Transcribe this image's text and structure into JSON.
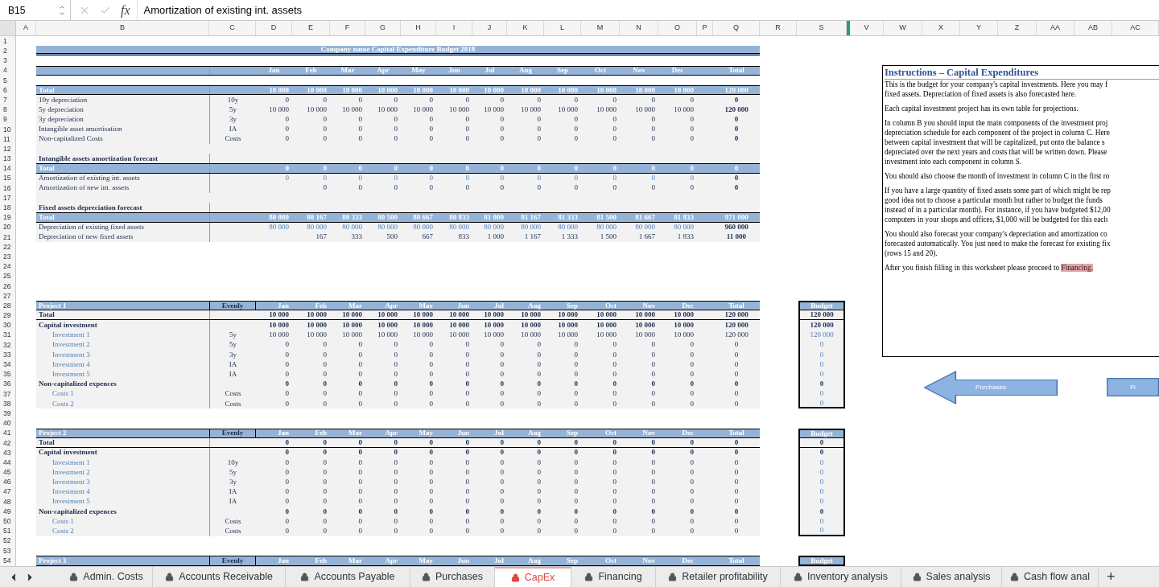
{
  "formula_bar": {
    "cell_ref": "B15",
    "fx": "fx",
    "formula": "Amortization of existing int. assets"
  },
  "columns": [
    "A",
    "B",
    "C",
    "D",
    "E",
    "F",
    "G",
    "H",
    "I",
    "J",
    "K",
    "L",
    "M",
    "N",
    "O",
    "P",
    "Q",
    "R",
    "S",
    "V",
    "W",
    "X",
    "Y",
    "Z",
    "AA",
    "AB",
    "AC"
  ],
  "rows": [
    {
      "number": "1",
      "kind": "blank"
    },
    {
      "number": "2",
      "kind": "title",
      "title": "Company name Capital Expenditure Budget 2018"
    },
    {
      "number": "3",
      "kind": "blank"
    },
    {
      "number": "4",
      "kind": "header",
      "values": [
        "Jan",
        "Feb",
        "Mar",
        "Apr",
        "May",
        "Jun",
        "Jul",
        "Aug",
        "Sep",
        "Oct",
        "Nov",
        "Dec"
      ],
      "total": "Total"
    },
    {
      "number": "5",
      "kind": "blank"
    },
    {
      "number": "6",
      "kind": "band",
      "label": "Total",
      "values": [
        "10 000",
        "10 000",
        "10 000",
        "10 000",
        "10 000",
        "10 000",
        "10 000",
        "10 000",
        "10 000",
        "10 000",
        "10 000",
        "10 000"
      ],
      "total": "120 000"
    },
    {
      "number": "7",
      "kind": "line",
      "label": "10y depreciation",
      "code": "10y",
      "values": [
        "0",
        "0",
        "0",
        "0",
        "0",
        "0",
        "0",
        "0",
        "0",
        "0",
        "0",
        "0"
      ],
      "total": "0"
    },
    {
      "number": "8",
      "kind": "line",
      "label": "5y depreciation",
      "code": "5y",
      "values": [
        "10 000",
        "10 000",
        "10 000",
        "10 000",
        "10 000",
        "10 000",
        "10 000",
        "10 000",
        "10 000",
        "10 000",
        "10 000",
        "10 000"
      ],
      "total": "120 000"
    },
    {
      "number": "9",
      "kind": "line",
      "label": "3y depreciation",
      "code": "3y",
      "values": [
        "0",
        "0",
        "0",
        "0",
        "0",
        "0",
        "0",
        "0",
        "0",
        "0",
        "0",
        "0"
      ],
      "total": "0"
    },
    {
      "number": "10",
      "kind": "line",
      "label": "Intangible asset amortisation",
      "code": "IA",
      "values": [
        "0",
        "0",
        "0",
        "0",
        "0",
        "0",
        "0",
        "0",
        "0",
        "0",
        "0",
        "0"
      ],
      "total": "0"
    },
    {
      "number": "11",
      "kind": "line",
      "label": "Non-capitalized Costs",
      "code": "Costs",
      "values": [
        "0",
        "0",
        "0",
        "0",
        "0",
        "0",
        "0",
        "0",
        "0",
        "0",
        "0",
        "0"
      ],
      "total": "0"
    },
    {
      "number": "12",
      "kind": "gap"
    },
    {
      "number": "13",
      "kind": "subheading",
      "label": "Intangible assets amortization forecast"
    },
    {
      "number": "14",
      "kind": "band",
      "label": "Total",
      "values": [
        "0",
        "0",
        "0",
        "0",
        "0",
        "0",
        "0",
        "0",
        "0",
        "0",
        "0",
        "0"
      ],
      "total": "0"
    },
    {
      "number": "15",
      "kind": "input",
      "label": "Amortization of existing int. assets",
      "values": [
        "0",
        "0",
        "0",
        "0",
        "0",
        "0",
        "0",
        "0",
        "0",
        "0",
        "0",
        "0"
      ],
      "total": "0"
    },
    {
      "number": "16",
      "kind": "line",
      "label": "Amortization of new int. assets",
      "leading_blank": true,
      "values": [
        "0",
        "0",
        "0",
        "0",
        "0",
        "0",
        "0",
        "0",
        "0",
        "0",
        "0"
      ],
      "total": "0"
    },
    {
      "number": "17",
      "kind": "gap"
    },
    {
      "number": "18",
      "kind": "subheading",
      "label": "Fixed assets depreciation forecast"
    },
    {
      "number": "19",
      "kind": "band",
      "label": "Total",
      "values": [
        "80 000",
        "80 167",
        "80 333",
        "80 500",
        "80 667",
        "80 833",
        "81 000",
        "81 167",
        "81 333",
        "81 500",
        "81 667",
        "81 833"
      ],
      "total": "971 000"
    },
    {
      "number": "20",
      "kind": "input",
      "label": "Depreciation of existing fixed assets",
      "values": [
        "80 000",
        "80 000",
        "80 000",
        "80 000",
        "80 000",
        "80 000",
        "80 000",
        "80 000",
        "80 000",
        "80 000",
        "80 000",
        "80 000"
      ],
      "total": "960 000"
    },
    {
      "number": "21",
      "kind": "line",
      "label": "Depreciation of new fixed assets",
      "leading_blank": true,
      "values": [
        "167",
        "333",
        "500",
        "667",
        "833",
        "1 000",
        "1 167",
        "1 333",
        "1 500",
        "1 667",
        "1 833"
      ],
      "total": "11 000"
    },
    {
      "number": "22",
      "kind": "blank"
    },
    {
      "number": "23",
      "kind": "blank"
    },
    {
      "number": "24",
      "kind": "blank"
    },
    {
      "number": "25",
      "kind": "blank"
    },
    {
      "number": "26",
      "kind": "blank"
    },
    {
      "number": "27",
      "kind": "blank"
    },
    {
      "number": "28",
      "kind": "project_header",
      "label": "Project 1",
      "code": "Evenly",
      "values": [
        "Jan",
        "Feb",
        "Mar",
        "Apr",
        "May",
        "Jun",
        "Jul",
        "Aug",
        "Sep",
        "Oct",
        "Nov",
        "Dec"
      ],
      "total": "Total",
      "budget": "Budget"
    },
    {
      "number": "29",
      "kind": "project_total",
      "label": "Total",
      "values": [
        "10 000",
        "10 000",
        "10 000",
        "10 000",
        "10 000",
        "10 000",
        "10 000",
        "10 000",
        "10 000",
        "10 000",
        "10 000",
        "10 000"
      ],
      "total": "120 000",
      "budget": "120 000"
    },
    {
      "number": "30",
      "kind": "group",
      "label": "Capital investment",
      "values": [
        "10 000",
        "10 000",
        "10 000",
        "10 000",
        "10 000",
        "10 000",
        "10 000",
        "10 000",
        "10 000",
        "10 000",
        "10 000",
        "10 000"
      ],
      "total": "120 000",
      "budget": "120 000"
    },
    {
      "number": "31",
      "kind": "component",
      "label": "Investment 1",
      "code": "5y",
      "values": [
        "10 000",
        "10 000",
        "10 000",
        "10 000",
        "10 000",
        "10 000",
        "10 000",
        "10 000",
        "10 000",
        "10 000",
        "10 000",
        "10 000"
      ],
      "total": "120 000",
      "budget": "120 000"
    },
    {
      "number": "32",
      "kind": "component",
      "label": "Investment 2",
      "code": "5y",
      "values": [
        "0",
        "0",
        "0",
        "0",
        "0",
        "0",
        "0",
        "0",
        "0",
        "0",
        "0",
        "0"
      ],
      "total": "0",
      "budget": "0"
    },
    {
      "number": "33",
      "kind": "component",
      "label": "Investment 3",
      "code": "3y",
      "values": [
        "0",
        "0",
        "0",
        "0",
        "0",
        "0",
        "0",
        "0",
        "0",
        "0",
        "0",
        "0"
      ],
      "total": "0",
      "budget": "0"
    },
    {
      "number": "34",
      "kind": "component",
      "label": "Investment 4",
      "code": "IA",
      "values": [
        "0",
        "0",
        "0",
        "0",
        "0",
        "0",
        "0",
        "0",
        "0",
        "0",
        "0",
        "0"
      ],
      "total": "0",
      "budget": "0"
    },
    {
      "number": "35",
      "kind": "component",
      "label": "Investment 5",
      "code": "IA",
      "values": [
        "0",
        "0",
        "0",
        "0",
        "0",
        "0",
        "0",
        "0",
        "0",
        "0",
        "0",
        "0"
      ],
      "total": "0",
      "budget": "0"
    },
    {
      "number": "36",
      "kind": "group",
      "label": "Non-capitalized expences",
      "values": [
        "0",
        "0",
        "0",
        "0",
        "0",
        "0",
        "0",
        "0",
        "0",
        "0",
        "0",
        "0"
      ],
      "total": "0",
      "budget": "0"
    },
    {
      "number": "37",
      "kind": "component",
      "label": "Costs 1",
      "code": "Costs",
      "values": [
        "0",
        "0",
        "0",
        "0",
        "0",
        "0",
        "0",
        "0",
        "0",
        "0",
        "0",
        "0"
      ],
      "total": "0",
      "budget": "0"
    },
    {
      "number": "38",
      "kind": "component",
      "label": "Costs 2",
      "code": "Costs",
      "values": [
        "0",
        "0",
        "0",
        "0",
        "0",
        "0",
        "0",
        "0",
        "0",
        "0",
        "0",
        "0"
      ],
      "total": "0",
      "budget": "0"
    },
    {
      "number": "39",
      "kind": "blank"
    },
    {
      "number": "40",
      "kind": "blank"
    },
    {
      "number": "41",
      "kind": "project_header",
      "label": "Project 2",
      "code": "Evenly",
      "values": [
        "Jan",
        "Feb",
        "Mar",
        "Apr",
        "May",
        "Jun",
        "Jul",
        "Aug",
        "Sep",
        "Oct",
        "Nov",
        "Dec"
      ],
      "total": "Total",
      "budget": "Budget"
    },
    {
      "number": "42",
      "kind": "project_total",
      "label": "Total",
      "values": [
        "0",
        "0",
        "0",
        "0",
        "0",
        "0",
        "0",
        "0",
        "0",
        "0",
        "0",
        "0"
      ],
      "total": "0",
      "budget": "0"
    },
    {
      "number": "43",
      "kind": "group",
      "label": "Capital investment",
      "values": [
        "0",
        "0",
        "0",
        "0",
        "0",
        "0",
        "0",
        "0",
        "0",
        "0",
        "0",
        "0"
      ],
      "total": "0",
      "budget": "0"
    },
    {
      "number": "44",
      "kind": "component",
      "label": "Investment 1",
      "code": "10y",
      "values": [
        "0",
        "0",
        "0",
        "0",
        "0",
        "0",
        "0",
        "0",
        "0",
        "0",
        "0",
        "0"
      ],
      "total": "0",
      "budget": "0"
    },
    {
      "number": "45",
      "kind": "component",
      "label": "Investment 2",
      "code": "5y",
      "values": [
        "0",
        "0",
        "0",
        "0",
        "0",
        "0",
        "0",
        "0",
        "0",
        "0",
        "0",
        "0"
      ],
      "total": "0",
      "budget": "0"
    },
    {
      "number": "46",
      "kind": "component",
      "label": "Investment 3",
      "code": "3y",
      "values": [
        "0",
        "0",
        "0",
        "0",
        "0",
        "0",
        "0",
        "0",
        "0",
        "0",
        "0",
        "0"
      ],
      "total": "0",
      "budget": "0"
    },
    {
      "number": "47",
      "kind": "component",
      "label": "Investment 4",
      "code": "IA",
      "values": [
        "0",
        "0",
        "0",
        "0",
        "0",
        "0",
        "0",
        "0",
        "0",
        "0",
        "0",
        "0"
      ],
      "total": "0",
      "budget": "0"
    },
    {
      "number": "48",
      "kind": "component",
      "label": "Investment 5",
      "code": "IA",
      "values": [
        "0",
        "0",
        "0",
        "0",
        "0",
        "0",
        "0",
        "0",
        "0",
        "0",
        "0",
        "0"
      ],
      "total": "0",
      "budget": "0"
    },
    {
      "number": "49",
      "kind": "group",
      "label": "Non-capitalized expences",
      "values": [
        "0",
        "0",
        "0",
        "0",
        "0",
        "0",
        "0",
        "0",
        "0",
        "0",
        "0",
        "0"
      ],
      "total": "0",
      "budget": "0"
    },
    {
      "number": "50",
      "kind": "component",
      "label": "Costs 1",
      "code": "Costs",
      "values": [
        "0",
        "0",
        "0",
        "0",
        "0",
        "0",
        "0",
        "0",
        "0",
        "0",
        "0",
        "0"
      ],
      "total": "0",
      "budget": "0"
    },
    {
      "number": "51",
      "kind": "component",
      "label": "Costs 2",
      "code": "Costs",
      "values": [
        "0",
        "0",
        "0",
        "0",
        "0",
        "0",
        "0",
        "0",
        "0",
        "0",
        "0",
        "0"
      ],
      "total": "0",
      "budget": "0"
    },
    {
      "number": "52",
      "kind": "blank"
    },
    {
      "number": "53",
      "kind": "blank"
    },
    {
      "number": "54",
      "kind": "project_header",
      "label": "Project 3",
      "code": "Evenly",
      "values": [
        "Jan",
        "Feb",
        "Mar",
        "Apr",
        "May",
        "Jun",
        "Jul",
        "Aug",
        "Sep",
        "Oct",
        "Nov",
        "Dec"
      ],
      "total": "Total",
      "budget": "Budget"
    }
  ],
  "instructions": {
    "title": "Instructions – Capital Expenditures",
    "paragraphs": [
      {
        "lines": [
          "This is the budget for your company's capital investments. Here you may f",
          "fixed assets. Depreciation of fixed assets is also forecasted here."
        ]
      },
      {
        "lines": [
          "Each capital investment project has its own table for projections."
        ]
      },
      {
        "lines": [
          "In column B you should input the main components of the investment proj",
          "depreciation schedule for each component of the project in column C. Here",
          "between capital investment that will be capitalized, put onto the balance s",
          "depreciated over the next years and costs that will be written down. Please",
          "investment into each component in column S."
        ]
      },
      {
        "lines": [
          "You should also choose the month of investment in column C in the first ro"
        ]
      },
      {
        "lines": [
          "If you have a large quantity of fixed assets some part of which might be rep",
          "good idea not to choose a particular month but rather to budget the funds",
          "instead of in a particular month). For instance, if you have budgeted $12,00",
          "computers in your shops and offices, $1,000 will be budgeted for this each"
        ]
      },
      {
        "lines": [
          "You should also forecast your company's depreciation and amortization co",
          "forecasted automatically. You just need to make the forecast for existing fix",
          "(rows 15 and 20)."
        ]
      },
      {
        "lines": [
          "After you finish filling in this worksheet please proceed to"
        ],
        "link": "Financing."
      }
    ]
  },
  "nav_buttons": [
    {
      "label": "Purchases",
      "kind": "left_arrow"
    },
    {
      "label": "Fi",
      "kind": "rectangle"
    }
  ],
  "tabs": [
    {
      "label": "Admin. Costs",
      "selected": false
    },
    {
      "label": "Accounts Receivable",
      "selected": false
    },
    {
      "label": "Accounts Payable",
      "selected": false
    },
    {
      "label": "Purchases",
      "selected": false
    },
    {
      "label": "CapEx",
      "selected": true
    },
    {
      "label": "Financing",
      "selected": false
    },
    {
      "label": "Retailer profitability",
      "selected": false
    },
    {
      "label": "Inventory analysis",
      "selected": false
    },
    {
      "label": "Sales analysis",
      "selected": false
    },
    {
      "label": "Cash flow anal",
      "selected": false
    }
  ],
  "add_tab": "+"
}
